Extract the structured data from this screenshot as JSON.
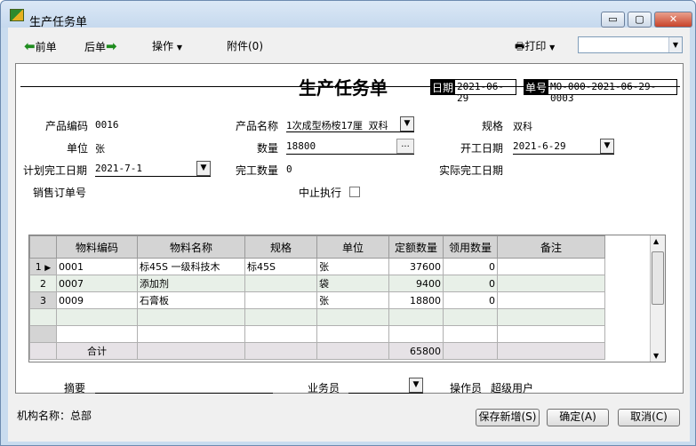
{
  "window": {
    "title": "生产任务单",
    "min_label": "▭",
    "max_label": "▢",
    "close_label": "✕"
  },
  "toolbar": {
    "prev_label": "前单",
    "next_label": "后单",
    "ops_label": "操作",
    "attach_label": "附件(0)",
    "print_label": "打印",
    "print_combo_value": ""
  },
  "form": {
    "title": "生产任务单",
    "date_label": "日期",
    "date_value": "2021-06-29",
    "order_no_label": "单号",
    "order_no_value": "MO-000-2021-06-29-0003",
    "product_code_label": "产品编码",
    "product_code_value": "0016",
    "product_name_label": "产品名称",
    "product_name_value": "1次成型杨桉17厘  双科",
    "spec_label": "规格",
    "spec_value": "双科",
    "unit_label": "单位",
    "unit_value": "张",
    "qty_label": "数量",
    "qty_value": "18800",
    "qty_btn": "...",
    "start_date_label": "开工日期",
    "start_date_value": "2021-6-29",
    "plan_end_label": "计划完工日期",
    "plan_end_value": "2021-7-1",
    "done_qty_label": "完工数量",
    "done_qty_value": "0",
    "actual_end_label": "实际完工日期",
    "actual_end_value": "",
    "sales_order_label": "销售订单号",
    "sales_order_value": "",
    "stop_label": "中止执行",
    "summary_label": "摘要",
    "summary_value": "",
    "salesman_label": "业务员",
    "salesman_value": "",
    "operator_label": "操作员",
    "operator_value": "超级用户"
  },
  "grid": {
    "headers": [
      "物料编码",
      "物料名称",
      "规格",
      "单位",
      "定额数量",
      "领用数量",
      "备注"
    ],
    "rows": [
      {
        "n": "1",
        "code": "0001",
        "name": "标45S 一级科技木",
        "spec": "标45S",
        "unit": "张",
        "quota": "37600",
        "used": "0",
        "note": ""
      },
      {
        "n": "2",
        "code": "0007",
        "name": "添加剂",
        "spec": "",
        "unit": "袋",
        "quota": "9400",
        "used": "0",
        "note": ""
      },
      {
        "n": "3",
        "code": "0009",
        "name": "石膏板",
        "spec": "",
        "unit": "张",
        "quota": "18800",
        "used": "0",
        "note": ""
      }
    ],
    "total_label": "合计",
    "total_quota": "65800"
  },
  "footer": {
    "org_label": "机构名称：总部",
    "save_new_label": "保存新增(S)",
    "ok_label": "确定(A)",
    "cancel_label": "取消(C)"
  }
}
